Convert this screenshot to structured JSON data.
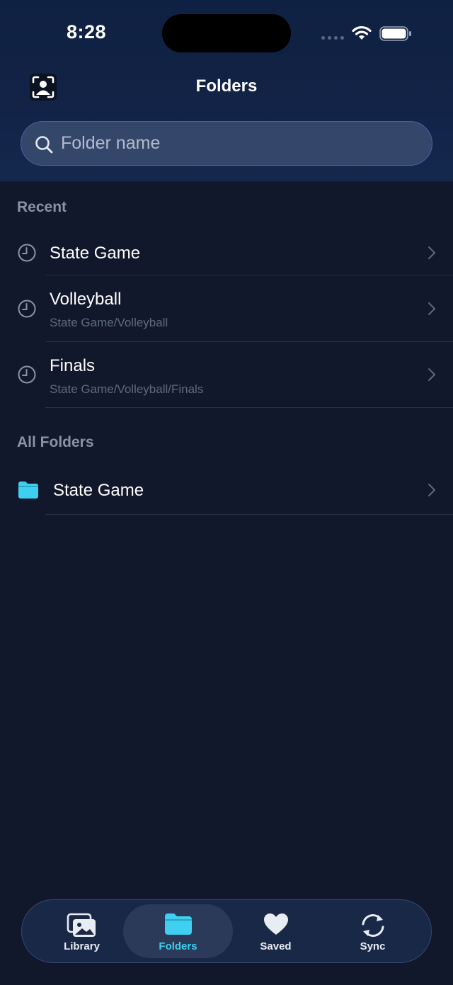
{
  "status_bar": {
    "time": "8:28"
  },
  "header": {
    "title": "Folders"
  },
  "search": {
    "placeholder": "Folder name",
    "value": ""
  },
  "recent": {
    "title": "Recent",
    "items": [
      {
        "title": "State Game",
        "subtitle": "",
        "icon": "clock-icon"
      },
      {
        "title": "Volleyball",
        "subtitle": "State Game/Volleyball",
        "icon": "clock-icon"
      },
      {
        "title": "Finals",
        "subtitle": "State Game/Volleyball/Finals",
        "icon": "clock-icon"
      }
    ]
  },
  "all_folders": {
    "title": "All Folders",
    "items": [
      {
        "title": "State Game",
        "icon": "folder-icon"
      }
    ]
  },
  "tabbar": {
    "tabs": [
      {
        "label": "Library",
        "icon": "photo-library-icon",
        "active": false
      },
      {
        "label": "Folders",
        "icon": "folder-icon",
        "active": true
      },
      {
        "label": "Saved",
        "icon": "heart-icon",
        "active": false
      },
      {
        "label": "Sync",
        "icon": "sync-icon",
        "active": false
      }
    ]
  },
  "colors": {
    "accent": "#3fd0f1",
    "background": "#11182b",
    "header": "#122347",
    "secondary_text": "#8a93a4"
  }
}
